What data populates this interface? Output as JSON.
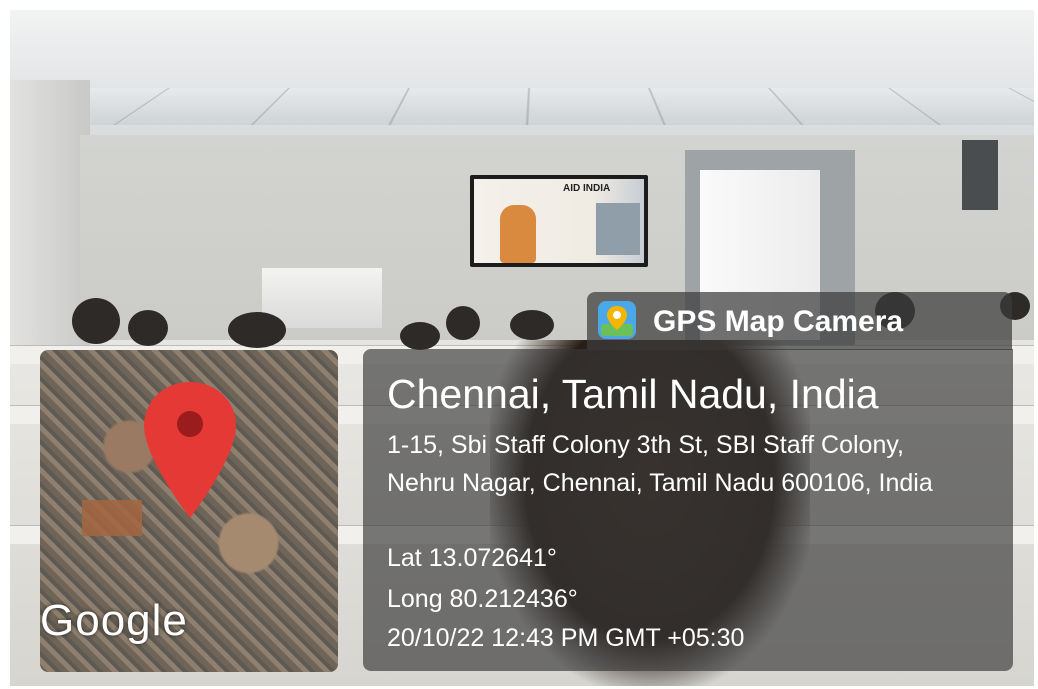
{
  "background": {
    "tv_logo": "AID INDIA"
  },
  "app": {
    "name": "GPS Map Camera"
  },
  "location": {
    "city": "Chennai, Tamil Nadu, India",
    "address": "1-15, Sbi Staff Colony 3th St, SBI Staff Colony, Nehru Nagar, Chennai, Tamil Nadu 600106, India",
    "lat": "Lat 13.072641°",
    "long": "Long 80.212436°",
    "datetime": "20/10/22 12:43 PM GMT +05:30"
  },
  "map": {
    "provider": "Google",
    "pin_color": "#e53935",
    "icons": [
      "map-pin-icon",
      "gps-map-camera-icon"
    ]
  }
}
